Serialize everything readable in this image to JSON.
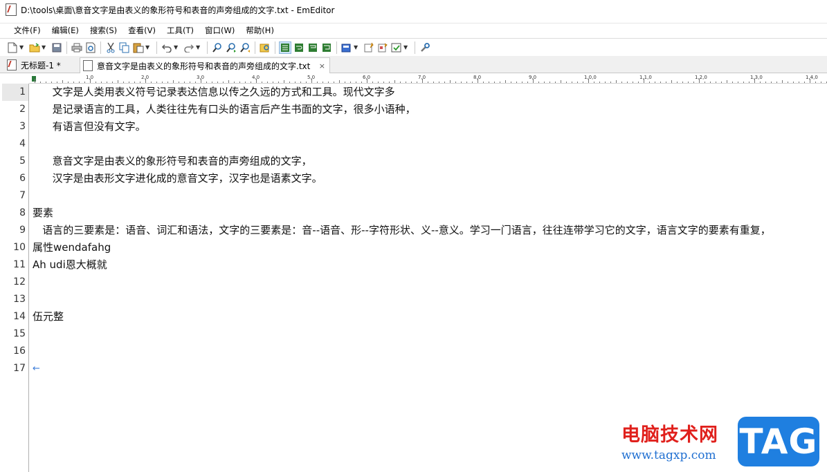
{
  "window": {
    "title": "D:\\tools\\桌面\\意音文字是由表义的象形符号和表音的声旁组成的文字.txt - EmEditor"
  },
  "menu": [
    "文件(F)",
    "编辑(E)",
    "搜索(S)",
    "查看(V)",
    "工具(T)",
    "窗口(W)",
    "帮助(H)"
  ],
  "toolbar": {
    "icons": [
      "new-file-icon",
      "open-folder-icon",
      "save-icon",
      "print-icon",
      "print-preview-icon",
      "cut-icon",
      "copy-icon",
      "paste-icon",
      "undo-icon",
      "redo-icon",
      "find-icon",
      "find-next-icon",
      "find-prev-icon",
      "find-in-files-icon",
      "wrap-none-icon",
      "wrap-chars-icon",
      "wrap-window-icon",
      "wrap-page-icon",
      "configuration-icon",
      "macro-icon",
      "plugin-icon",
      "check-icon",
      "tools-icon"
    ]
  },
  "tabs": [
    {
      "label": "无标题-1 *",
      "active": false
    },
    {
      "label": "意音文字是由表义的象形符号和表音的声旁组成的文字.txt",
      "active": true,
      "close": "×"
    }
  ],
  "ruler": {
    "labels": [
      "1,0",
      "2,0",
      "3,0",
      "4,0",
      "5,0",
      "6,0",
      "7,0",
      "8,0",
      "9,0",
      "1,0,0",
      "1,1,0",
      "1,2,0",
      "1,3,0",
      "1,4,0"
    ]
  },
  "editor": {
    "current_line": 1,
    "lines": [
      {
        "n": "1",
        "text": "      文字是人类用表义符号记录表达信息以传之久远的方式和工具。现代文字多"
      },
      {
        "n": "2",
        "text": "      是记录语言的工具，人类往往先有口头的语言后产生书面的文字，很多小语种，"
      },
      {
        "n": "3",
        "text": "      有语言但没有文字。"
      },
      {
        "n": "4",
        "text": ""
      },
      {
        "n": "5",
        "text": "      意音文字是由表义的象形符号和表音的声旁组成的文字，"
      },
      {
        "n": "6",
        "text": "      汉字是由表形文字进化成的意音文字，汉字也是语素文字。"
      },
      {
        "n": "7",
        "text": ""
      },
      {
        "n": "8",
        "text": "要素"
      },
      {
        "n": "9",
        "text": "   语言的三要素是：语音、词汇和语法，文字的三要素是：音--语音、形--字符形状、义--意义。学习一门语言，往往连带学习它的文字，语言文字的要素有重复，"
      },
      {
        "n": "10",
        "text": "属性wendafahg"
      },
      {
        "n": "11",
        "text": "Ah udi恩大概就"
      },
      {
        "n": "12",
        "text": ""
      },
      {
        "n": "13",
        "text": ""
      },
      {
        "n": "14",
        "text": "伍元整"
      },
      {
        "n": "15",
        "text": ""
      },
      {
        "n": "16",
        "text": ""
      },
      {
        "n": "17",
        "text": ""
      }
    ],
    "eof_mark": "←"
  },
  "watermark": {
    "cn": "电脑技术网",
    "url": "www.tagxp.com",
    "badge": "TAG"
  }
}
